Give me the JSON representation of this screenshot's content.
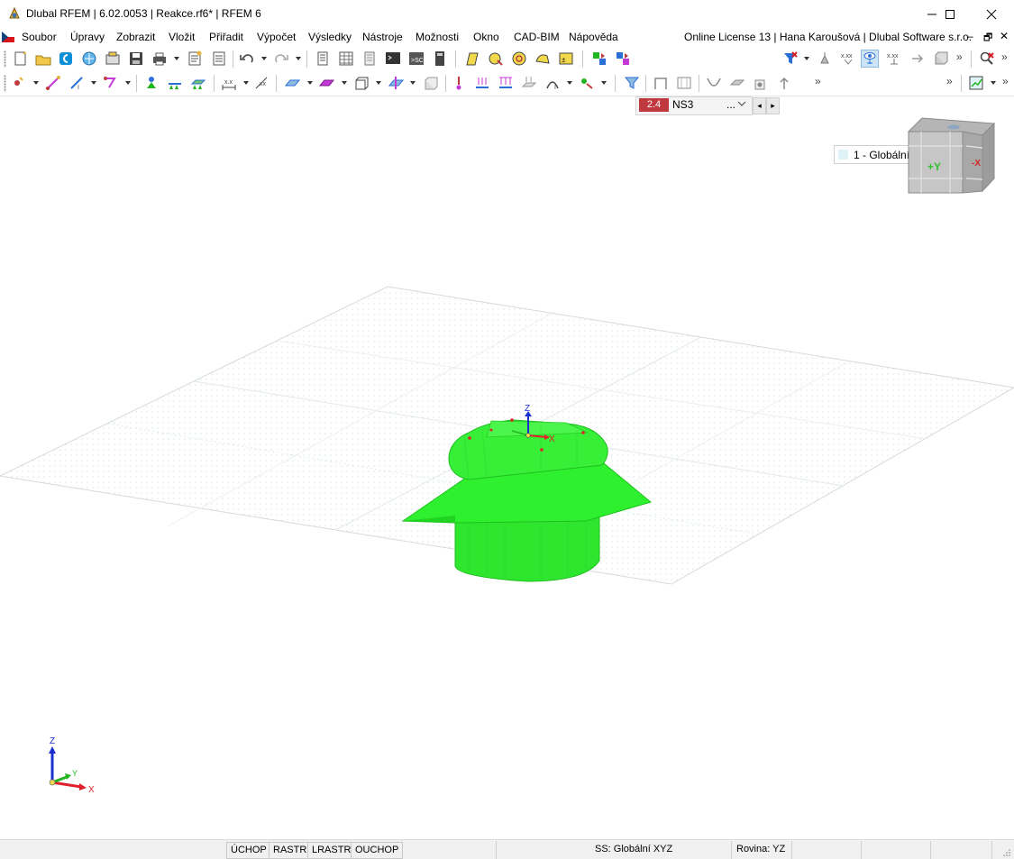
{
  "window": {
    "title": "Dlubal RFEM | 6.02.0053 | Reakce.rf6* | RFEM 6",
    "minimize": "—",
    "maximize": "☐",
    "close": "✕"
  },
  "menu": {
    "items": [
      "Soubor",
      "Úpravy",
      "Zobrazit",
      "Vložit",
      "Přiřadit",
      "Výpočet",
      "Výsledky",
      "Nástroje",
      "Možnosti",
      "Okno",
      "CAD-BIM",
      "Nápověda"
    ],
    "license": "Online License 13 | Hana Karoušová | Dlubal Software s.r.o.",
    "mdi_minimize": "–",
    "mdi_restore": "🗗",
    "mdi_close": "✕"
  },
  "toolbar": {
    "load_case_number": "2.4",
    "load_case_name": "NS3",
    "load_case_more": "...",
    "coordinate_system": "1 - Globální XYZ",
    "overflow": "»",
    "colors": {
      "load_case_badge": "#c0393f"
    }
  },
  "viewport": {
    "nav_cube": {
      "plus_y": "+Y",
      "minus_x": "-X"
    },
    "origin_axis_z": "Z",
    "origin_axis_x": "X",
    "corner_axis_z": "Z",
    "corner_axis_y": "Y",
    "corner_axis_x": "X",
    "colors": {
      "solid": "#19e619",
      "axis_z": "#1a2fcf",
      "axis_x": "#e0202a",
      "axis_y": "#22b522"
    }
  },
  "status": {
    "snap_buttons": [
      "ÚCHOP",
      "RASTR",
      "LRASTR",
      "OUCHOP"
    ],
    "coordinate_system": "SS: Globální XYZ",
    "plane": "Rovina: YZ"
  }
}
